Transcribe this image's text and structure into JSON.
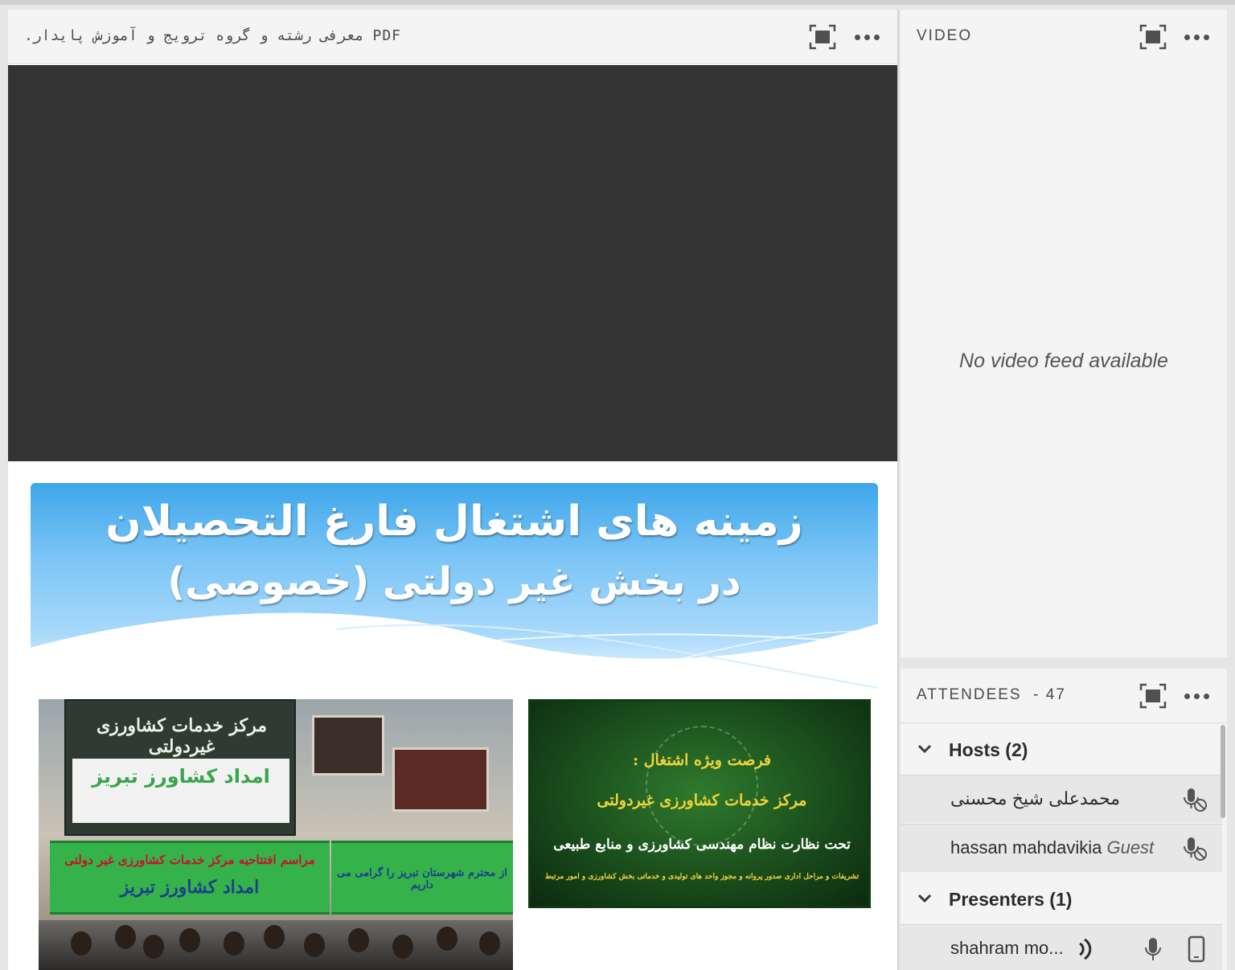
{
  "share_pod": {
    "title": ".معرفی رشته و گروه ترویج و آموزش پایدار PDF",
    "fullscreen_icon": "fullscreen-icon",
    "menu_icon": "more-options-icon"
  },
  "slide": {
    "title_line1": "زمینه های اشتغال فارغ التحصیلان",
    "title_line2": "در بخش غیر دولتی (خصوصی)",
    "photo_left": {
      "sign_title": "مرکز خدمات کشاورزی غیردولتی",
      "sign_subtitle": "امداد کشاورز تبریز",
      "banner1": "مراسم افتتاحیه مرکز خدمات کشاورزی غیر دولتی",
      "banner1_line2": "امداد کشاورز تبریز",
      "banner2": "از محترم شهرستان تبریز را گرامی می داریم"
    },
    "photo_right": {
      "line1": "فرصت ویژه اشتغال :",
      "line2": "مرکز خدمات کشاورزی غیردولتی",
      "line3": "تحت نظارت نظام مهندسی کشاورزی و منابع طبیعی",
      "line4": "تشریفات و مراحل اداری صدور پروانه و مجوز واحد های تولیدی و خدماتی بخش کشاورزی و امور مرتبط"
    }
  },
  "video_pod": {
    "title": "VIDEO",
    "empty_message": "No video feed available"
  },
  "attendees_pod": {
    "title": "ATTENDEES",
    "count_label": "- 47",
    "groups": [
      {
        "label": "Hosts (2)",
        "users": [
          {
            "name": "محمدعلی شیخ محسنی",
            "role": "",
            "icon": "mic-disabled-icon"
          },
          {
            "name": "hassan mahdavikia",
            "role": "Guest",
            "icon": "mic-disabled-icon"
          }
        ]
      },
      {
        "label": "Presenters (1)",
        "users": [
          {
            "name": "shahram mo...",
            "role": "",
            "icon": "mic-icon"
          }
        ]
      }
    ]
  },
  "colors": {
    "pod_bg": "#f4f4f4",
    "dark_area": "#333333",
    "banner_blue": "#3da6ea",
    "green_banner": "#35b24a"
  }
}
